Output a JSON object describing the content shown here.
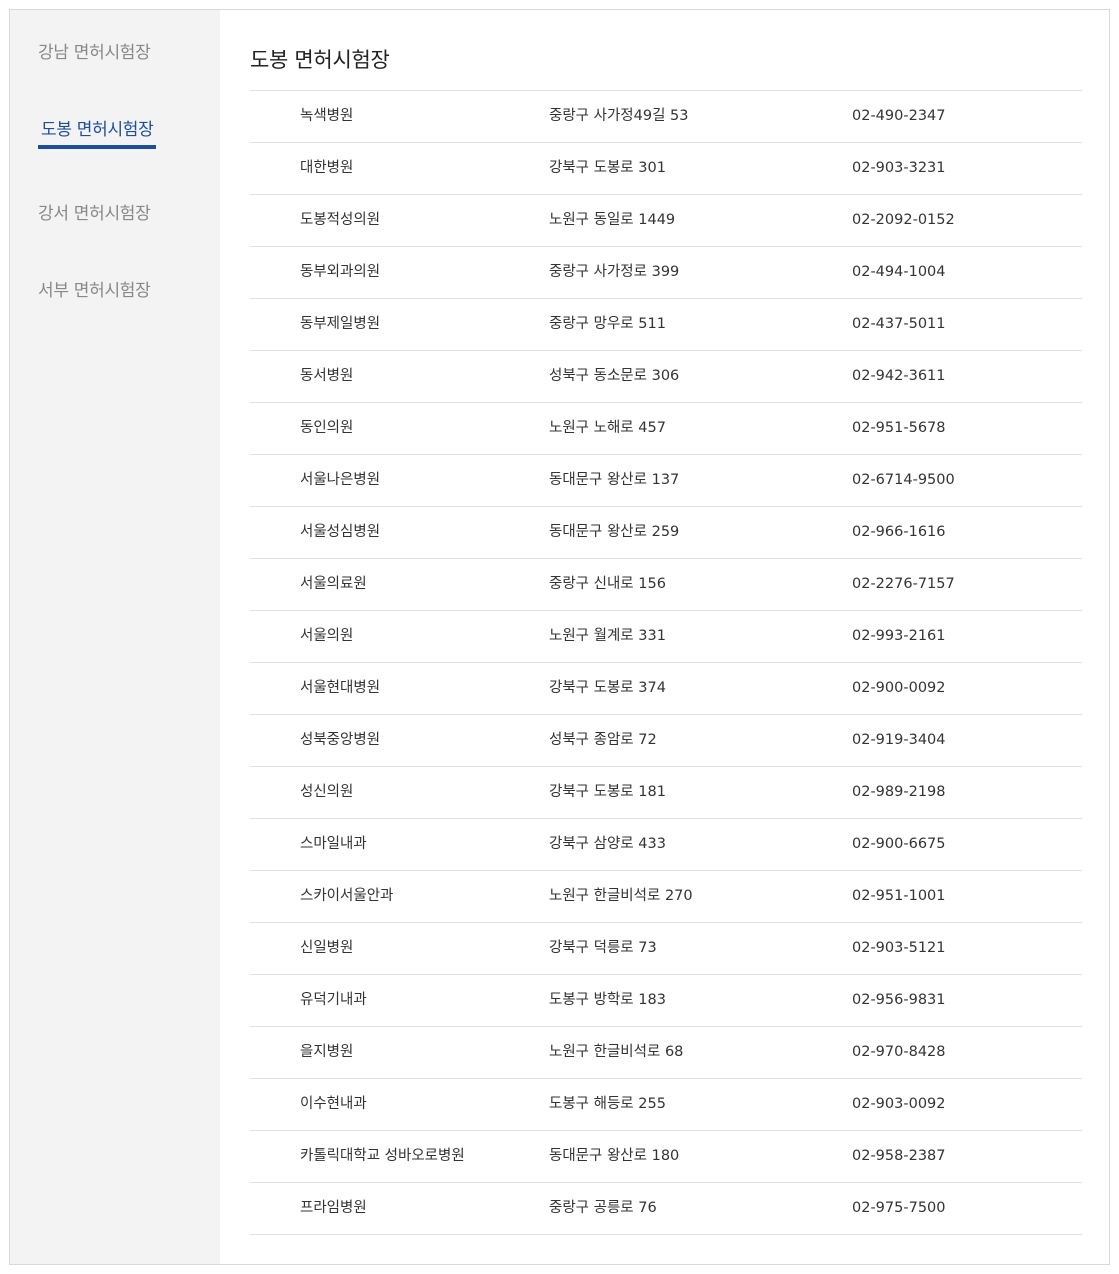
{
  "sidebar": {
    "items": [
      {
        "label": "강남 면허시험장",
        "active": false
      },
      {
        "label": "도봉 면허시험장",
        "active": true
      },
      {
        "label": "강서 면허시험장",
        "active": false
      },
      {
        "label": "서부 면허시험장",
        "active": false
      }
    ]
  },
  "colors": {
    "accent": "#1d4e9a",
    "sidebar_bg": "#f3f3f3",
    "inactive_text": "#888888",
    "divider": "#e1e1e1"
  },
  "main": {
    "title": "도봉 면허시험장",
    "rows": [
      {
        "name": "녹색병원",
        "address": "중랑구 사가정49길 53",
        "phone": "02-490-2347"
      },
      {
        "name": "대한병원",
        "address": "강북구 도봉로 301",
        "phone": "02-903-3231"
      },
      {
        "name": "도봉적성의원",
        "address": "노원구 동일로 1449",
        "phone": "02-2092-0152"
      },
      {
        "name": "동부외과의원",
        "address": "중랑구 사가정로 399",
        "phone": "02-494-1004"
      },
      {
        "name": "동부제일병원",
        "address": "중랑구 망우로 511",
        "phone": "02-437-5011"
      },
      {
        "name": "동서병원",
        "address": "성북구 동소문로 306",
        "phone": "02-942-3611"
      },
      {
        "name": "동인의원",
        "address": "노원구 노해로 457",
        "phone": "02-951-5678"
      },
      {
        "name": "서울나은병원",
        "address": "동대문구 왕산로 137",
        "phone": "02-6714-9500"
      },
      {
        "name": "서울성심병원",
        "address": "동대문구 왕산로 259",
        "phone": "02-966-1616"
      },
      {
        "name": "서울의료원",
        "address": "중랑구 신내로 156",
        "phone": "02-2276-7157"
      },
      {
        "name": "서울의원",
        "address": "노원구 월계로 331",
        "phone": "02-993-2161"
      },
      {
        "name": "서울현대병원",
        "address": "강북구 도봉로 374",
        "phone": "02-900-0092"
      },
      {
        "name": "성북중앙병원",
        "address": "성북구 종암로 72",
        "phone": "02-919-3404"
      },
      {
        "name": "성신의원",
        "address": "강북구 도봉로 181",
        "phone": "02-989-2198"
      },
      {
        "name": "스마일내과",
        "address": "강북구 삼양로 433",
        "phone": "02-900-6675"
      },
      {
        "name": "스카이서울안과",
        "address": "노원구 한글비석로 270",
        "phone": "02-951-1001"
      },
      {
        "name": "신일병원",
        "address": "강북구 덕릉로 73",
        "phone": "02-903-5121"
      },
      {
        "name": "유덕기내과",
        "address": "도봉구 방학로 183",
        "phone": "02-956-9831"
      },
      {
        "name": "을지병원",
        "address": "노원구 한글비석로 68",
        "phone": "02-970-8428"
      },
      {
        "name": "이수현내과",
        "address": "도봉구 해등로 255",
        "phone": "02-903-0092"
      },
      {
        "name": "카톨릭대학교 성바오로병원",
        "address": "동대문구 왕산로 180",
        "phone": "02-958-2387"
      },
      {
        "name": "프라임병원",
        "address": "중랑구 공릉로 76",
        "phone": "02-975-7500"
      }
    ]
  }
}
